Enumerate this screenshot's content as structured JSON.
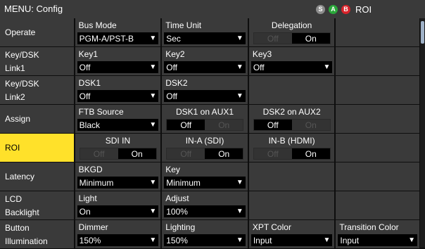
{
  "titlebar": {
    "title": "MENU: Config",
    "badges": [
      "S",
      "A",
      "B"
    ],
    "roi": "ROI"
  },
  "rows": [
    {
      "label1": "Operate",
      "label2": "",
      "cells": [
        {
          "type": "select",
          "name": "Bus Mode",
          "value": "PGM-A/PST-B"
        },
        {
          "type": "select",
          "name": "Time Unit",
          "value": "Sec"
        },
        {
          "type": "toggle",
          "name": "Delegation",
          "off": "Off",
          "on": "On",
          "state": "on"
        },
        {
          "type": "empty"
        }
      ]
    },
    {
      "label1": "Key/DSK",
      "label2": "Link1",
      "cells": [
        {
          "type": "select",
          "name": "Key1",
          "value": "Off"
        },
        {
          "type": "select",
          "name": "Key2",
          "value": "Off"
        },
        {
          "type": "select",
          "name": "Key3",
          "value": "Off"
        },
        {
          "type": "empty"
        }
      ]
    },
    {
      "label1": "Key/DSK",
      "label2": "Link2",
      "cells": [
        {
          "type": "select",
          "name": "DSK1",
          "value": "Off"
        },
        {
          "type": "select",
          "name": "DSK2",
          "value": "Off"
        },
        {
          "type": "empty"
        },
        {
          "type": "empty"
        }
      ]
    },
    {
      "label1": "Assign",
      "label2": "",
      "cells": [
        {
          "type": "select",
          "name": "FTB Source",
          "value": "Black"
        },
        {
          "type": "toggle",
          "name": "DSK1 on AUX1",
          "off": "Off",
          "on": "On",
          "state": "off"
        },
        {
          "type": "toggle",
          "name": "DSK2 on AUX2",
          "off": "Off",
          "on": "On",
          "state": "off"
        },
        {
          "type": "empty"
        }
      ]
    },
    {
      "label1": "ROI",
      "label2": "",
      "highlight": true,
      "cells": [
        {
          "type": "toggle",
          "name": "SDI IN",
          "off": "Off",
          "on": "On",
          "state": "on"
        },
        {
          "type": "toggle",
          "name": "IN-A (SDI)",
          "off": "Off",
          "on": "On",
          "state": "on"
        },
        {
          "type": "toggle",
          "name": "IN-B (HDMI)",
          "off": "Off",
          "on": "On",
          "state": "on"
        },
        {
          "type": "empty"
        }
      ]
    },
    {
      "label1": "Latency",
      "label2": "",
      "cells": [
        {
          "type": "select",
          "name": "BKGD",
          "value": "Minimum"
        },
        {
          "type": "select",
          "name": "Key",
          "value": "Minimum"
        },
        {
          "type": "empty"
        },
        {
          "type": "empty"
        }
      ]
    },
    {
      "label1": "LCD",
      "label2": "Backlight",
      "cells": [
        {
          "type": "select",
          "name": "Light",
          "value": "On"
        },
        {
          "type": "select",
          "name": "Adjust",
          "value": "100%"
        },
        {
          "type": "empty"
        },
        {
          "type": "empty"
        }
      ]
    },
    {
      "label1": "Button",
      "label2": "Illumination",
      "cells": [
        {
          "type": "select",
          "name": "Dimmer",
          "value": "150%"
        },
        {
          "type": "select",
          "name": "Lighting",
          "value": "150%"
        },
        {
          "type": "select",
          "name": "XPT Color",
          "value": "Input"
        },
        {
          "type": "select",
          "name": "Transition Color",
          "value": "Input"
        }
      ]
    }
  ],
  "colors": {
    "panel": "#3a3a3a",
    "highlight": "#ffe12a",
    "badge_s": "#8c8c8c",
    "badge_a": "#2aa83a",
    "badge_b": "#d8232a",
    "scroll_thumb": "#9fb1c7"
  },
  "icons": {
    "dropdown": "dropdown-arrow-icon"
  }
}
